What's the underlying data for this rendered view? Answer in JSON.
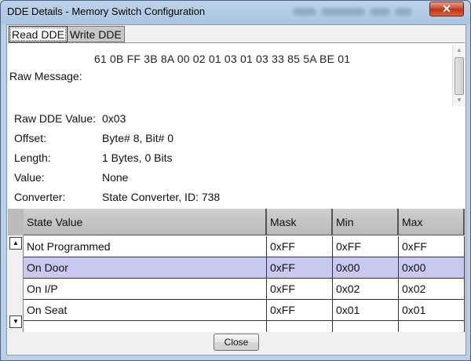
{
  "window": {
    "title": "DDE Details - Memory Switch Configuration",
    "close_glyph": "✕"
  },
  "tabs": [
    {
      "label": "Read DDE",
      "active": true
    },
    {
      "label": "Write DDE",
      "active": false
    }
  ],
  "raw": {
    "hex": "61 0B FF 3B 8A 00 02 01 03 01 03 33 85 5A BE 01",
    "label": "Raw Message:"
  },
  "props": [
    {
      "key": "Raw DDE Value:",
      "value": "0x03"
    },
    {
      "key": "Offset:",
      "value": "Byte# 8, Bit# 0"
    },
    {
      "key": "Length:",
      "value": "1 Bytes, 0 Bits"
    },
    {
      "key": "Value:",
      "value": "None"
    },
    {
      "key": "Converter:",
      "value": "State Converter, ID: 738"
    }
  ],
  "table": {
    "headers": [
      "State Value",
      "Mask",
      "Min",
      "Max"
    ],
    "rows": [
      [
        "Not Programmed",
        "0xFF",
        "0xFF",
        "0xFF"
      ],
      [
        "On Door",
        "0xFF",
        "0x00",
        "0x00"
      ],
      [
        "On I/P",
        "0xFF",
        "0x02",
        "0x02"
      ],
      [
        "On Seat",
        "0xFF",
        "0x01",
        "0x01"
      ]
    ],
    "selected_row": 1
  },
  "footer": {
    "close_label": "Close"
  }
}
